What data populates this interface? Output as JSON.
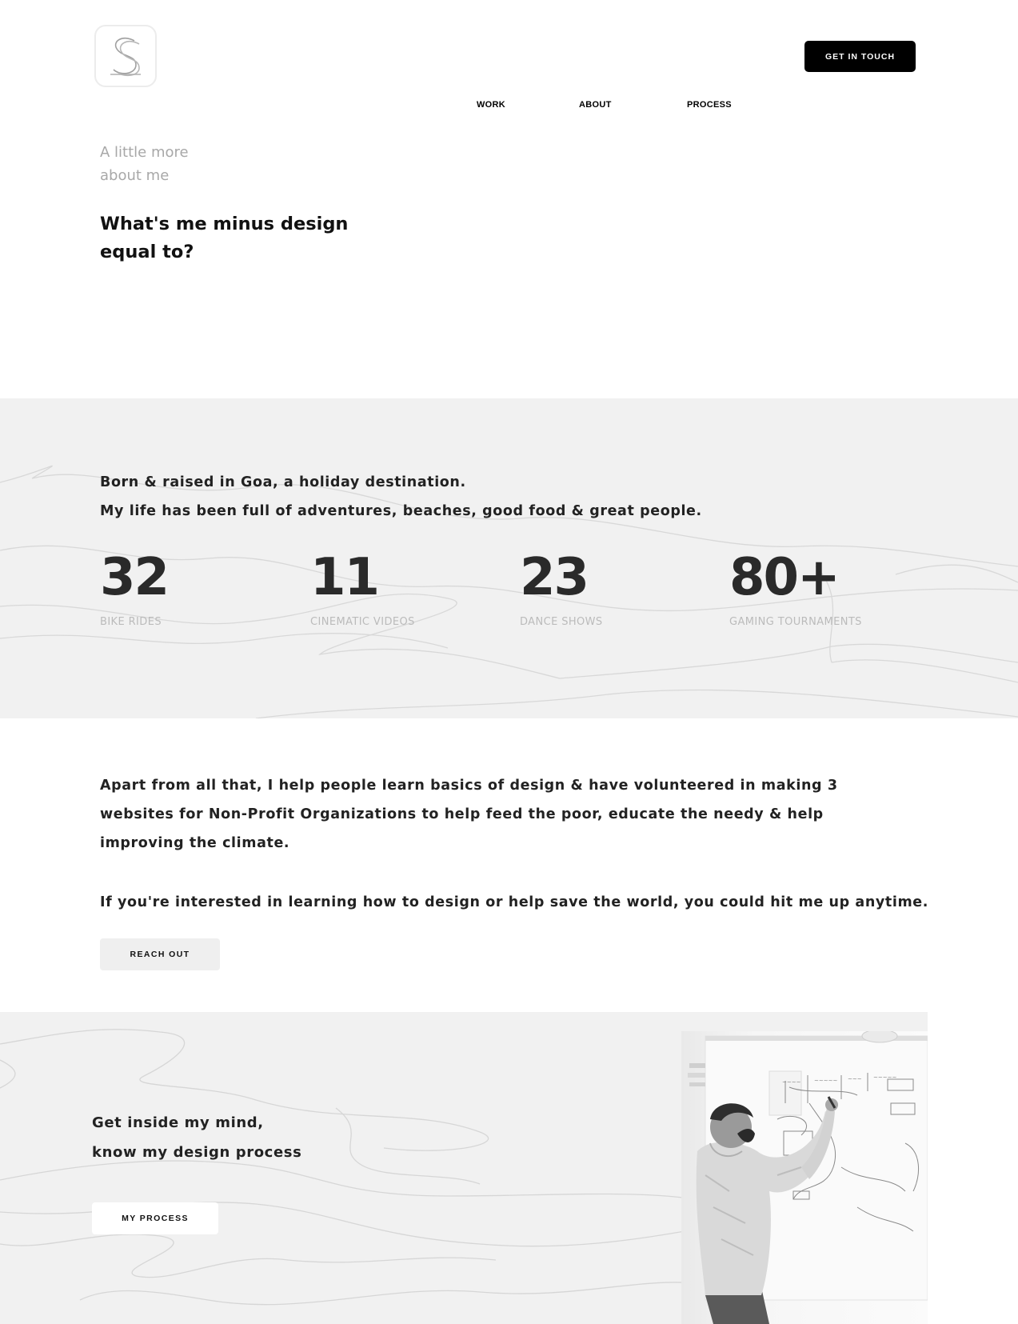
{
  "header": {
    "logo_letter": "S",
    "nav": {
      "work": "WORK",
      "about": "ABOUT",
      "process": "PROCESS"
    },
    "cta_label": "GET IN TOUCH"
  },
  "intro": {
    "kicker_line1": "A little more",
    "kicker_line2": "about me",
    "title_line1": "What's me minus design",
    "title_line2": "equal to?"
  },
  "bio": {
    "line1": "Born & raised in Goa, a holiday destination.",
    "line2": "My life has been full of adventures, beaches, good food & great people."
  },
  "stats": [
    {
      "value": "32",
      "label": "BIKE RIDES"
    },
    {
      "value": "11",
      "label": "CINEMATIC VIDEOS"
    },
    {
      "value": "23",
      "label": "DANCE SHOWS"
    },
    {
      "value": "80+",
      "label": "GAMING TOURNAMENTS"
    }
  ],
  "volunteer": {
    "text": "Apart from all that, I help people learn basics of design & have volunteered in making 3 websites for Non-Profit Organizations to help feed the poor, educate the needy & help improving the climate.",
    "invite": "If you're interested in learning how to design or help save the world, you could hit me up anytime.",
    "reach_label": "REACH OUT"
  },
  "process": {
    "line1": "Get inside my mind,",
    "line2": "know my design process",
    "button_label": "MY PROCESS"
  },
  "colors": {
    "band_bg": "#f1f1f1",
    "cta_bg": "#000000",
    "muted_text": "#a8a8a8"
  }
}
